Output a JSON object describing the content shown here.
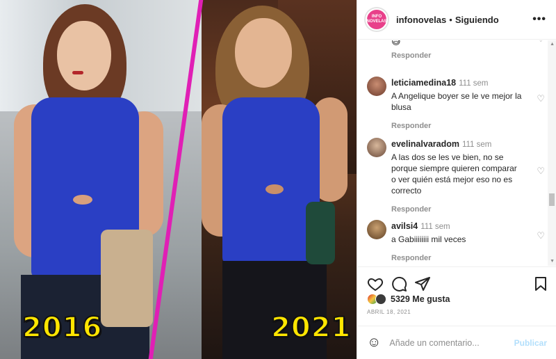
{
  "photo": {
    "year_left": "2016",
    "year_right": "2021"
  },
  "header": {
    "logo_text_1": "INFO",
    "logo_text_2": "NOVELAS",
    "username": "infonovelas",
    "separator": "•",
    "follow_label": "Siguiendo",
    "more_icon": "•••"
  },
  "comments": [
    {
      "emoji": "😅",
      "reply": "Responder"
    },
    {
      "user": "leticiamedina18",
      "time": "111 sem",
      "text": "A Angelique boyer se le ve mejor la blusa",
      "reply": "Responder"
    },
    {
      "user": "evelinalvaradom",
      "time": "111 sem",
      "text": "A las dos se les ve bien, no se porque siempre quieren comparar o ver quién está mejor eso no es correcto",
      "reply": "Responder"
    },
    {
      "user": "avilsi4",
      "time": "111 sem",
      "text": "a Gabiiiiiiii mil veces",
      "reply": "Responder"
    }
  ],
  "likes": {
    "count_text": "5329 Me gusta"
  },
  "date": "ABRIL 18, 2021",
  "add_comment": {
    "placeholder": "Añade un comentario...",
    "publish": "Publicar"
  },
  "colors": {
    "divider": "#e01fb5",
    "year_text": "#ffe600",
    "publish_disabled": "#b2dffc",
    "blouse": "#2a3fc4"
  }
}
